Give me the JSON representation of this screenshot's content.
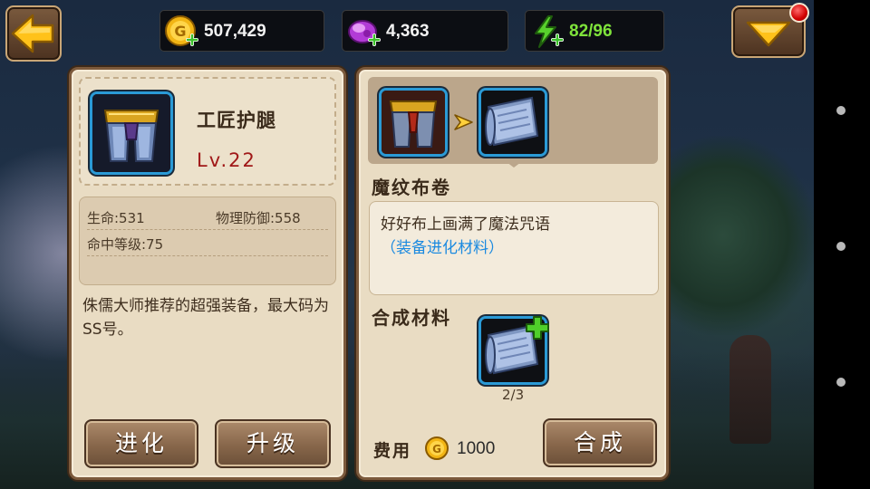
{
  "resources": {
    "gold": "507,429",
    "gems": "4,363",
    "stamina": "82/96"
  },
  "colors": {
    "panel_bg": "#e9dcc3",
    "panel_border": "#7c5a3c",
    "item_level": "#a01818",
    "link": "#1b8ae0",
    "stamina_text": "#7fe33b"
  },
  "item": {
    "name": "工匠护腿",
    "level": "Lv.22",
    "stats": {
      "hp": "生命:531",
      "phys_def": "物理防御:558",
      "hit": "命中等级:75"
    },
    "description": "侏儒大师推荐的超强装备，最大码为SS号。"
  },
  "left_buttons": {
    "evolve": "进化",
    "upgrade": "升级"
  },
  "material": {
    "name": "魔纹布卷",
    "description": "好好布上画满了魔法咒语",
    "type_link": "（装备进化材料）"
  },
  "craft": {
    "title": "合成材料",
    "count": "2/3",
    "fee_label": "费用",
    "fee_value": "1000",
    "button": "合成"
  },
  "icons": [
    "back-arrow-icon",
    "gold-coin-plus-icon",
    "gem-plus-icon",
    "lightning-plus-icon",
    "dropdown-arrow-icon",
    "leg-armor-icon",
    "scroll-icon",
    "arrow-right-icon",
    "plus-icon",
    "gold-coin-icon"
  ]
}
